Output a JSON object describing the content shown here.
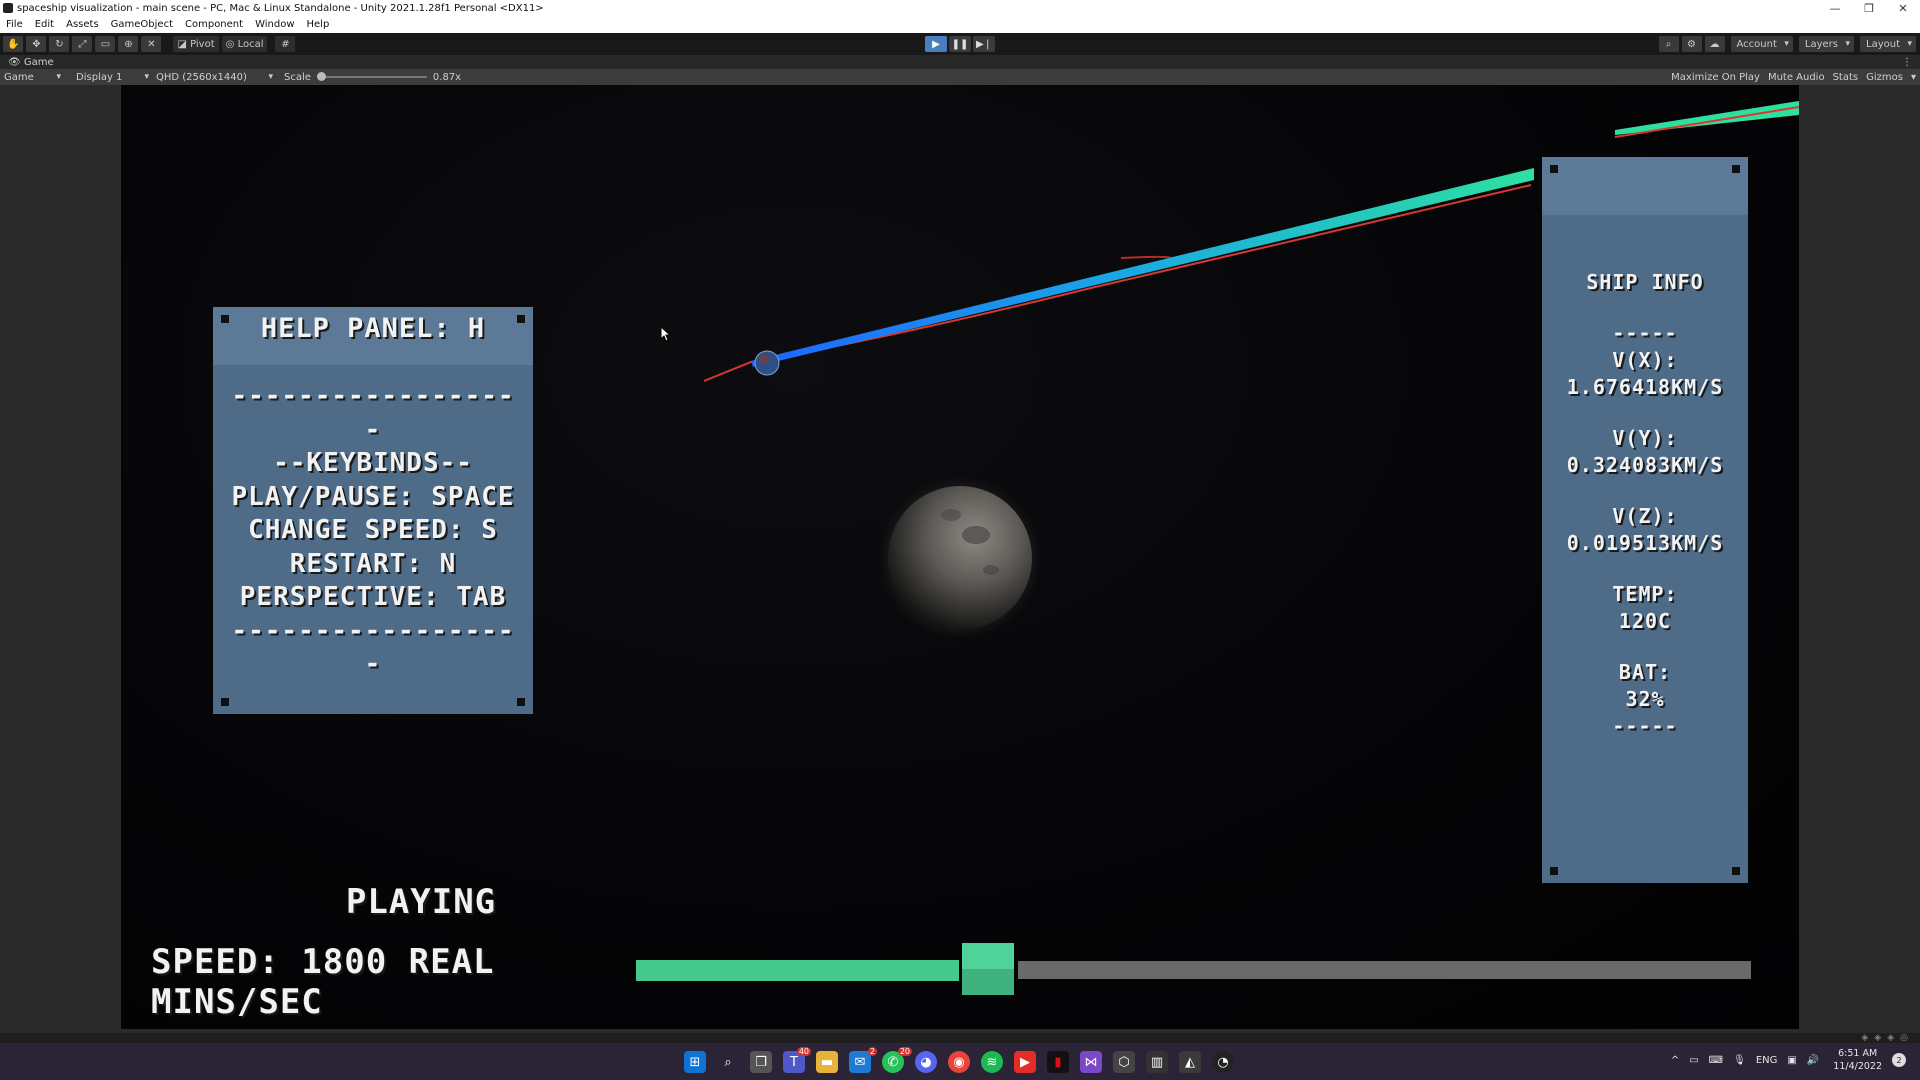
{
  "window": {
    "title": "spaceship visualization - main scene - PC, Mac & Linux Standalone - Unity 2021.1.28f1 Personal <DX11>",
    "controls": [
      "—",
      "❐",
      "✕"
    ]
  },
  "menubar": [
    "File",
    "Edit",
    "Assets",
    "GameObject",
    "Component",
    "Window",
    "Help"
  ],
  "toolbar": {
    "tools": [
      "hand-tool-icon",
      "move-tool-icon",
      "rotate-tool-icon",
      "scale-tool-icon",
      "rect-tool-icon",
      "transform-tool-icon",
      "custom-tool-icon"
    ],
    "pivot_label": "Pivot",
    "local_label": "Local",
    "account_label": "Account",
    "layers_label": "Layers",
    "layout_label": "Layout"
  },
  "game_tab": {
    "label": "Game",
    "menu": "⋮"
  },
  "game_bar": {
    "view_select": "Game",
    "display_select": "Display 1",
    "resolution_select": "QHD (2560x1440)",
    "scale_label": "Scale",
    "scale_value": "0.87x",
    "maximize_label": "Maximize On Play",
    "mute_label": "Mute Audio",
    "stats_label": "Stats",
    "gizmos_label": "Gizmos"
  },
  "help_panel": {
    "title": "HELP PANEL:  H",
    "lines": [
      "-----------------",
      "-",
      "--KEYBINDS--",
      "PLAY/PAUSE:  SPACE",
      "CHANGE SPEED:  S",
      "RESTART:  N",
      "PERSPECTIVE:  TAB",
      "-----------------",
      "-"
    ]
  },
  "ship_info": {
    "title": "SHIP INFO",
    "divider": "-----",
    "vx_label": "V(X):",
    "vx_value": "1.676418KM/S",
    "vy_label": "V(Y):",
    "vy_value": "0.324083KM/S",
    "vz_label": "V(Z):",
    "vz_value": "0.019513KM/S",
    "temp_label": "TEMP:",
    "temp_value": "120C",
    "bat_label": "BAT:",
    "bat_value": "32%",
    "divider_end": "-----"
  },
  "status": {
    "state": "PLAYING",
    "speed": "SPEED: 1800 REAL MINS/SEC"
  },
  "speed_slider": {
    "fraction": 0.29
  },
  "colors": {
    "panel": "#4e6b88",
    "panel_band": "#5c7a98",
    "slider_fill": "#45c98e",
    "trajectory_green": "#2ee0a0",
    "trajectory_blue": "#1e90ff",
    "trajectory_red": "#d63a2e"
  },
  "taskbar": {
    "apps": [
      "windows-start-icon",
      "search-icon",
      "task-view-icon",
      "teams-icon",
      "file-explorer-icon",
      "mail-icon",
      "whatsapp-icon",
      "discord-icon",
      "chrome-icon",
      "spotify-icon",
      "youtube-icon",
      "netflix-icon",
      "visual-studio-icon",
      "unity-hub-icon",
      "library-icon",
      "unity-icon",
      "obs-icon"
    ],
    "badges": {
      "teams": "40",
      "mail": "2",
      "whatsapp": "20"
    },
    "tray_lang": "ENG",
    "time": "6:51 AM",
    "date": "11/4/2022",
    "notifications": "2"
  }
}
